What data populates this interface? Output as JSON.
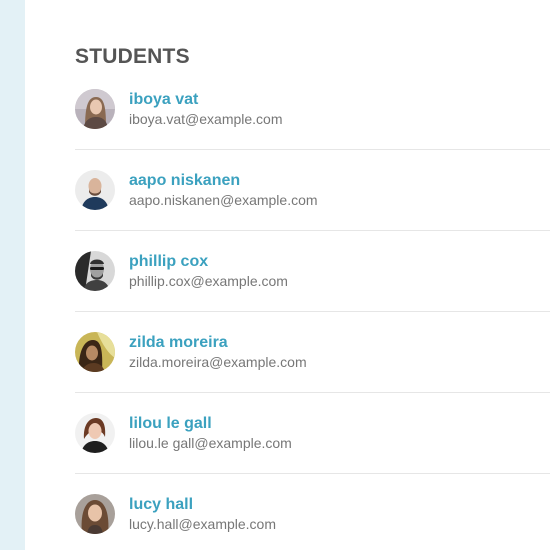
{
  "section": {
    "title": "STUDENTS"
  },
  "students": [
    {
      "name": "iboya vat",
      "email": "iboya.vat@example.com"
    },
    {
      "name": "aapo niskanen",
      "email": "aapo.niskanen@example.com"
    },
    {
      "name": "phillip cox",
      "email": "phillip.cox@example.com"
    },
    {
      "name": "zilda moreira",
      "email": "zilda.moreira@example.com"
    },
    {
      "name": "lilou le gall",
      "email": "lilou.le gall@example.com"
    },
    {
      "name": "lucy hall",
      "email": "lucy.hall@example.com"
    }
  ],
  "colors": {
    "accent": "#3ba1bf",
    "heading": "#555555",
    "secondary_text": "#777777",
    "sidebar_strip": "#e3f1f6",
    "divider": "#e6e6e6"
  }
}
